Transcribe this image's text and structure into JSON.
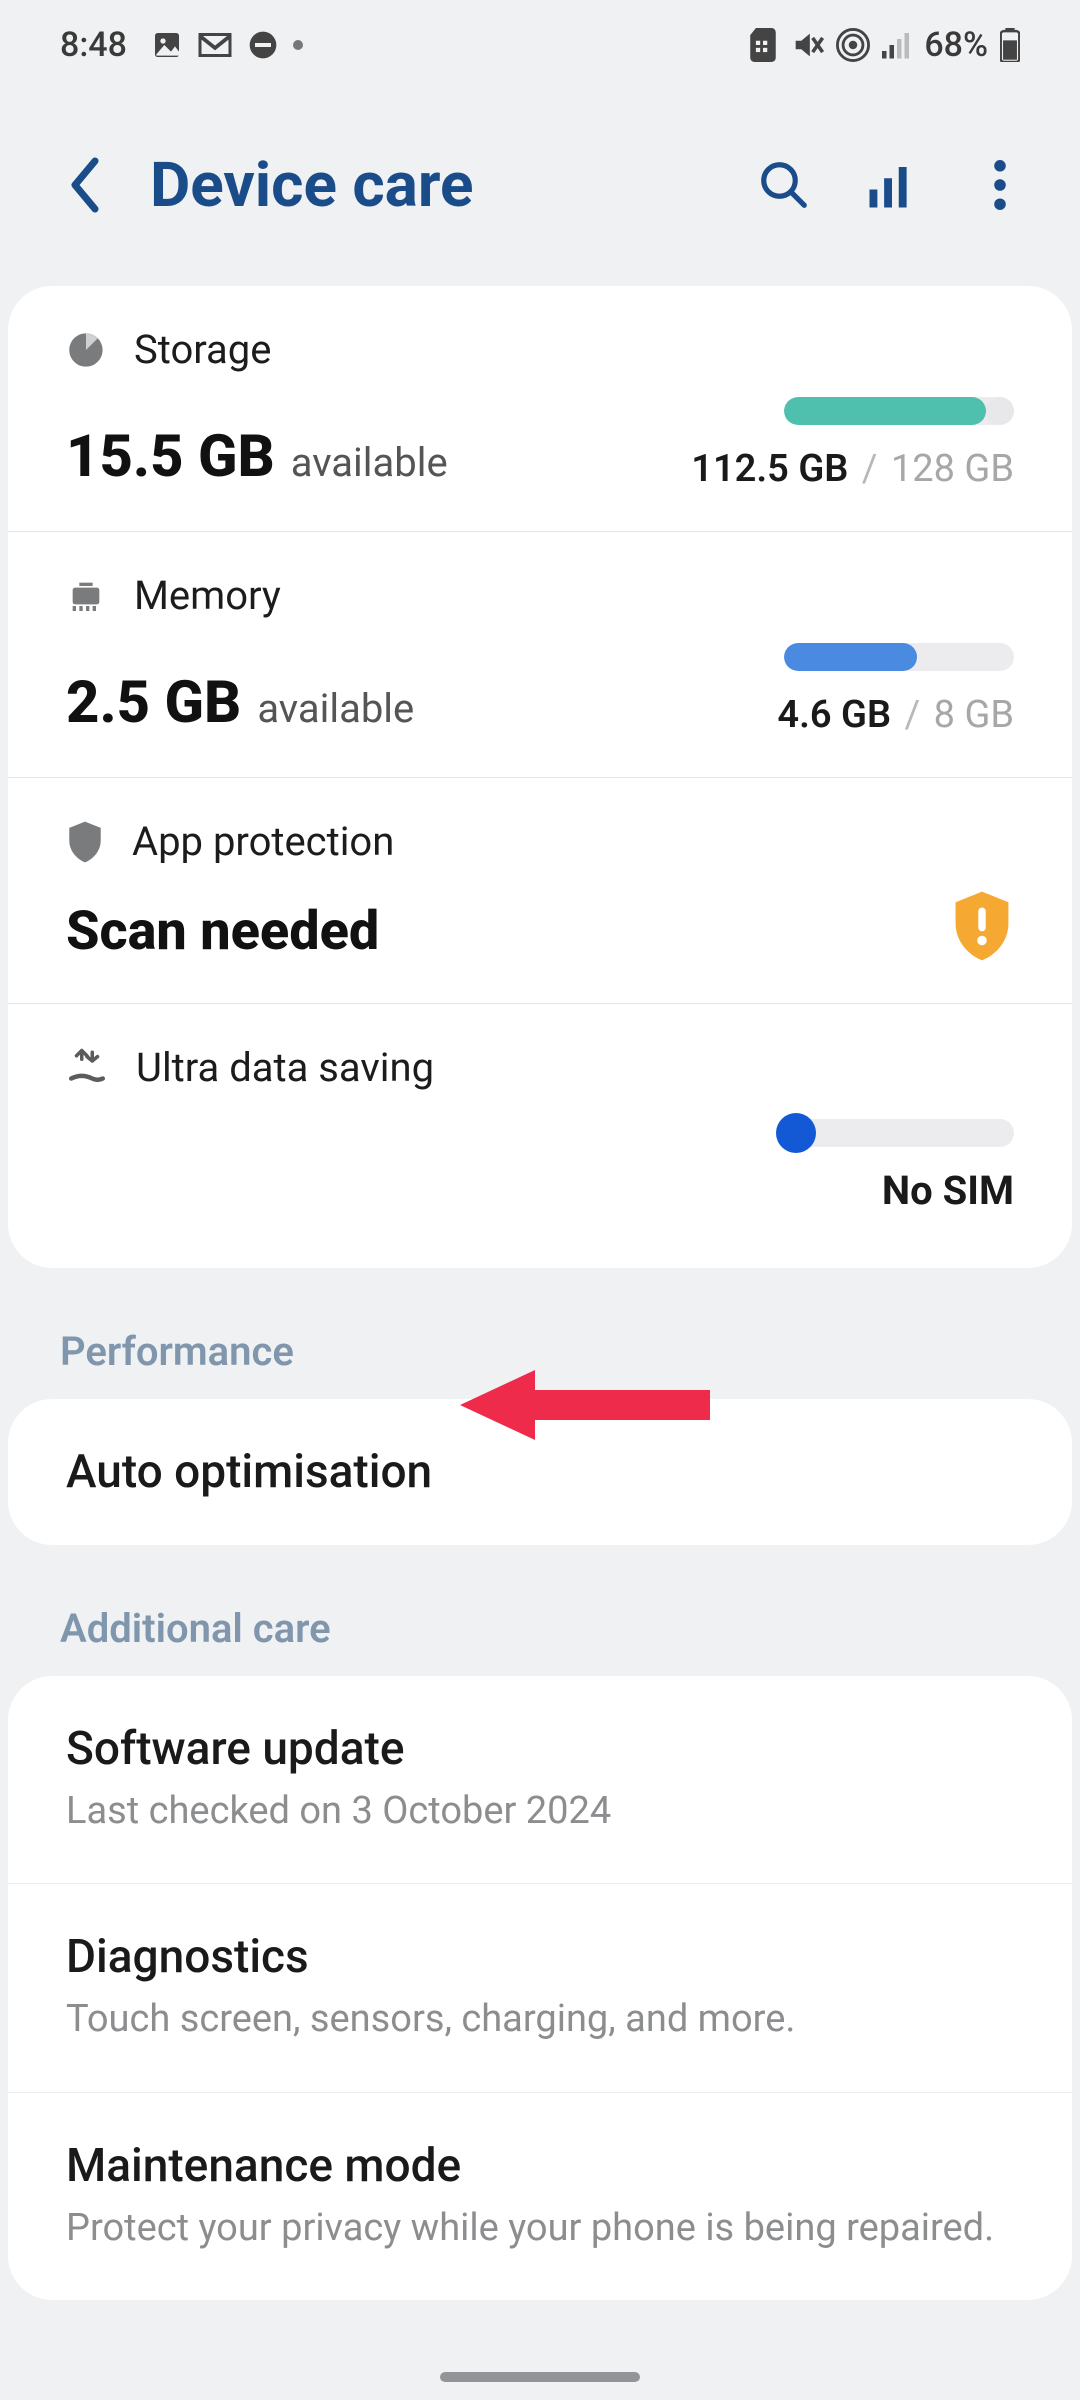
{
  "status": {
    "time": "8:48",
    "battery_pct": "68%"
  },
  "header": {
    "title": "Device care"
  },
  "storage": {
    "label": "Storage",
    "available_num": "15.5 GB",
    "available_suffix": "available",
    "used": "112.5 GB",
    "total": "128 GB"
  },
  "memory": {
    "label": "Memory",
    "available_num": "2.5 GB",
    "available_suffix": "available",
    "used": "4.6 GB",
    "total": "8 GB"
  },
  "app_protection": {
    "label": "App protection",
    "status": "Scan needed"
  },
  "ultra_data_saving": {
    "label": "Ultra data saving",
    "status": "No SIM"
  },
  "sections": {
    "performance": "Performance",
    "additional_care": "Additional care"
  },
  "performance": {
    "auto_optimisation": "Auto optimisation"
  },
  "additional_care": {
    "software_update": {
      "title": "Software update",
      "subtitle": "Last checked on 3 October 2024"
    },
    "diagnostics": {
      "title": "Diagnostics",
      "subtitle": "Touch screen, sensors, charging, and more."
    },
    "maintenance_mode": {
      "title": "Maintenance mode",
      "subtitle": "Protect your privacy while your phone is being repaired."
    }
  }
}
